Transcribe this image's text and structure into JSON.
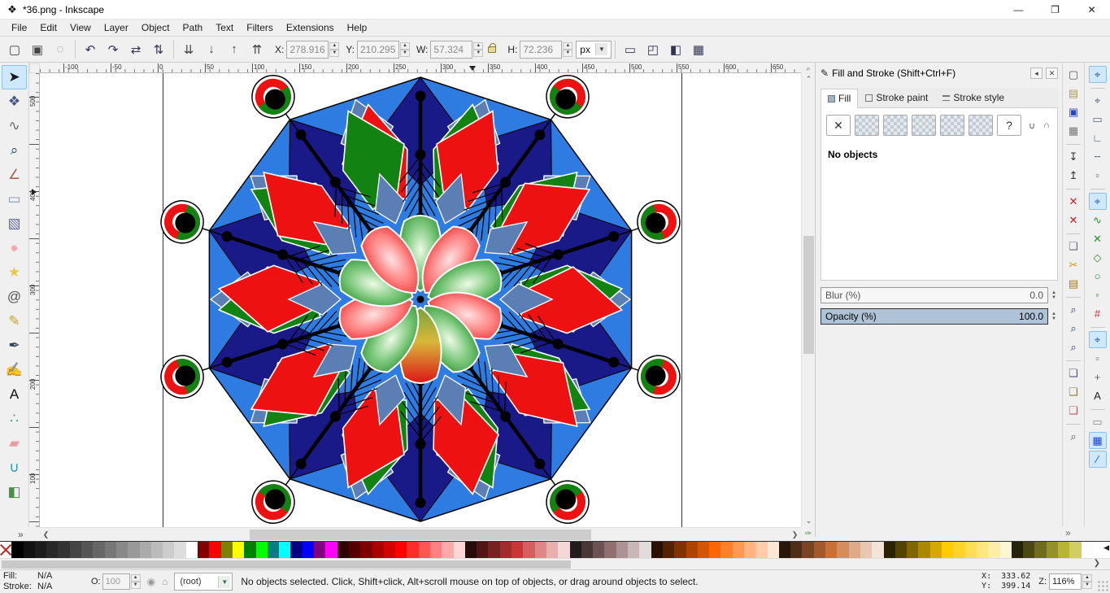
{
  "window": {
    "title": "*36.png - Inkscape",
    "app_icon_glyph": "❖",
    "minimize_glyph": "—",
    "maximize_glyph": "❐",
    "close_glyph": "✕"
  },
  "menu": {
    "items": [
      {
        "label": "File"
      },
      {
        "label": "Edit"
      },
      {
        "label": "View"
      },
      {
        "label": "Layer"
      },
      {
        "label": "Object"
      },
      {
        "label": "Path"
      },
      {
        "label": "Text"
      },
      {
        "label": "Filters"
      },
      {
        "label": "Extensions"
      },
      {
        "label": "Help"
      }
    ]
  },
  "ctrlbar": {
    "buttons_left": [
      {
        "name": "select-all",
        "glyph": "▢",
        "color": "#444"
      },
      {
        "name": "select-all-layers",
        "glyph": "▣",
        "color": "#444"
      },
      {
        "name": "deselect",
        "glyph": "◌",
        "color": "#888"
      },
      {
        "sep": true
      },
      {
        "name": "rotate-ccw",
        "glyph": "↶",
        "color": "#335"
      },
      {
        "name": "rotate-cw",
        "glyph": "↷",
        "color": "#335"
      },
      {
        "name": "flip-horizontal",
        "glyph": "⇄",
        "color": "#335"
      },
      {
        "name": "flip-vertical",
        "glyph": "⇅",
        "color": "#335"
      },
      {
        "sep": true
      },
      {
        "name": "lower-to-bottom",
        "glyph": "⇊",
        "color": "#444"
      },
      {
        "name": "lower",
        "glyph": "↓",
        "color": "#444"
      },
      {
        "name": "raise",
        "glyph": "↑",
        "color": "#444"
      },
      {
        "name": "raise-to-top",
        "glyph": "⇈",
        "color": "#444"
      }
    ],
    "fields": {
      "x_label": "X:",
      "x_value": "278.916",
      "y_label": "Y:",
      "y_value": "210.295",
      "w_label": "W:",
      "w_value": "57.324",
      "h_label": "H:",
      "h_value": "72.236",
      "unit": "px"
    },
    "toggles": [
      {
        "name": "transform-stroke",
        "glyph": "▭",
        "on": true,
        "color": "#335"
      },
      {
        "name": "transform-corners",
        "glyph": "◰",
        "on": true,
        "color": "#335"
      },
      {
        "name": "transform-gradients",
        "glyph": "◧",
        "on": true,
        "color": "#335"
      },
      {
        "name": "transform-patterns",
        "glyph": "▦",
        "on": true,
        "color": "#335"
      }
    ]
  },
  "toolbox": {
    "overflow_glyph": "»",
    "tools": [
      {
        "name": "selector",
        "glyph": "➤",
        "color": "#1a1a1a",
        "active": true
      },
      {
        "name": "node-editor",
        "glyph": "❖",
        "color": "#445588"
      },
      {
        "name": "tweak",
        "glyph": "∿",
        "color": "#666677"
      },
      {
        "name": "zoom",
        "glyph": "⌕",
        "color": "#224477"
      },
      {
        "name": "measure",
        "glyph": "∠",
        "color": "#aa6655"
      },
      {
        "name": "rectangle",
        "glyph": "▭",
        "color": "#7799bb"
      },
      {
        "name": "box-3d",
        "glyph": "▧",
        "color": "#6666aa"
      },
      {
        "name": "ellipse",
        "glyph": "●",
        "color": "#f2a9b2"
      },
      {
        "name": "star",
        "glyph": "★",
        "color": "#e8c94a"
      },
      {
        "name": "spiral",
        "glyph": "@",
        "color": "#555555"
      },
      {
        "name": "pencil",
        "glyph": "✎",
        "color": "#c9a227"
      },
      {
        "name": "bezier-pen",
        "glyph": "✒",
        "color": "#334455"
      },
      {
        "name": "calligraphy",
        "glyph": "✍",
        "color": "#223366"
      },
      {
        "name": "text",
        "glyph": "A",
        "color": "#111111"
      },
      {
        "name": "spray",
        "glyph": "∴",
        "color": "#33aa77"
      },
      {
        "name": "eraser",
        "glyph": "▰",
        "color": "#e8a0a8"
      },
      {
        "name": "paint-bucket",
        "glyph": "∪",
        "color": "#2299aa"
      },
      {
        "name": "gradient",
        "glyph": "◧",
        "color": "#4a8f4a"
      }
    ]
  },
  "rulers": {
    "h_labels": [
      -100,
      -50,
      0,
      50,
      100,
      150,
      200,
      250,
      300,
      350,
      400,
      450,
      500,
      550,
      600,
      650
    ],
    "v_labels": [
      500,
      400,
      300,
      200,
      100
    ]
  },
  "canvas": {
    "artwork": {
      "navy": "#191987",
      "cornflower": "#2e7ce2",
      "slate": "#5b7fb4",
      "red": "#ee1111",
      "green": "#128212",
      "outline": "#000000",
      "white": "#ffffff",
      "petal_red_light": "#ffe2e2",
      "petal_red_mid": "#ff8585",
      "petal_red_dark": "#dd0f0f",
      "petal_green_light": "#eefbe6",
      "petal_green_mid": "#7cc87c",
      "petal_green_dark": "#0e7a10",
      "petal_mix_top": "#dd1515",
      "petal_mix_mid": "#d8b83a",
      "petal_mix_bottom": "#76a23a"
    }
  },
  "panel": {
    "title": "Fill and Stroke (Shift+Ctrl+F)",
    "header_icon_glyph": "✎",
    "cycle_glyph": "◂",
    "close_glyph": "✕",
    "tabs": [
      {
        "label": "Fill",
        "active": true
      },
      {
        "label": "Stroke paint"
      },
      {
        "label": "Stroke style"
      }
    ],
    "paint_buttons": [
      {
        "name": "no-paint",
        "glyph": "✕",
        "plain": true
      },
      {
        "name": "flat-color",
        "glyph": ""
      },
      {
        "name": "linear-gradient",
        "glyph": ""
      },
      {
        "name": "radial-gradient",
        "glyph": ""
      },
      {
        "name": "pattern",
        "glyph": ""
      },
      {
        "name": "swatch",
        "glyph": ""
      },
      {
        "name": "unknown-paint",
        "glyph": "?",
        "plain": true
      }
    ],
    "fillrule": [
      {
        "name": "fill-rule-evenodd",
        "glyph": "∪"
      },
      {
        "name": "fill-rule-nonzero",
        "glyph": "∩"
      }
    ],
    "empty_message": "No objects",
    "blur_label": "Blur (%)",
    "blur_value": "0.0",
    "opacity_label": "Opacity (%)",
    "opacity_value": "100.0"
  },
  "commands_bar": [
    {
      "name": "new-document",
      "glyph": "▢",
      "color": "#555555"
    },
    {
      "name": "open-document",
      "glyph": "▤",
      "color": "#aa9955"
    },
    {
      "name": "save-document",
      "glyph": "▣",
      "color": "#2244cc"
    },
    {
      "name": "print",
      "glyph": "▦",
      "color": "#777777"
    },
    {
      "sep": true
    },
    {
      "name": "import",
      "glyph": "↧",
      "color": "#333333"
    },
    {
      "name": "export",
      "glyph": "↥",
      "color": "#333333"
    },
    {
      "sep": true
    },
    {
      "name": "undo",
      "glyph": "✕",
      "color": "#cc2222"
    },
    {
      "name": "redo",
      "glyph": "✕",
      "color": "#cc2222"
    },
    {
      "sep": true
    },
    {
      "name": "copy",
      "glyph": "❏",
      "color": "#666677"
    },
    {
      "name": "cut",
      "glyph": "✂",
      "color": "#cc9900"
    },
    {
      "name": "paste",
      "glyph": "▤",
      "color": "#aa7722"
    },
    {
      "sep": true
    },
    {
      "name": "zoom-to-selection",
      "glyph": "⌕",
      "color": "#224477"
    },
    {
      "name": "zoom-to-drawing",
      "glyph": "⌕",
      "color": "#224477"
    },
    {
      "name": "zoom-to-page",
      "glyph": "⌕",
      "color": "#224477"
    },
    {
      "sep": true
    },
    {
      "name": "duplicate",
      "glyph": "❏",
      "color": "#555577"
    },
    {
      "name": "create-clone",
      "glyph": "❏",
      "color": "#887744"
    },
    {
      "name": "unlink-clone",
      "glyph": "❏",
      "color": "#bb5555"
    },
    {
      "sep": true
    },
    {
      "name": "find-replace",
      "glyph": "⌕",
      "color": "#555555"
    }
  ],
  "snap_bar": [
    {
      "name": "snap-enable",
      "glyph": "⌖",
      "color": "#2255aa",
      "on": true
    },
    {
      "sep": true
    },
    {
      "name": "snap-bbox",
      "glyph": "⌖",
      "color": "#556677"
    },
    {
      "name": "snap-bbox-edges",
      "glyph": "▭",
      "color": "#556677"
    },
    {
      "name": "snap-bbox-corners",
      "glyph": "∟",
      "color": "#556677"
    },
    {
      "name": "snap-bbox-edge-midpoints",
      "glyph": "╌",
      "color": "#556677"
    },
    {
      "name": "snap-bbox-centers",
      "glyph": "▫",
      "color": "#556677"
    },
    {
      "sep": true
    },
    {
      "name": "snap-nodes",
      "glyph": "⌖",
      "color": "#2255aa",
      "on": true
    },
    {
      "name": "snap-paths",
      "glyph": "∿",
      "color": "#338833"
    },
    {
      "name": "snap-path-intersections",
      "glyph": "✕",
      "color": "#338833"
    },
    {
      "name": "snap-cusp-nodes",
      "glyph": "◇",
      "color": "#338833"
    },
    {
      "name": "snap-smooth-nodes",
      "glyph": "○",
      "color": "#338833"
    },
    {
      "name": "snap-line-midpoints",
      "glyph": "◦",
      "color": "#338833"
    },
    {
      "name": "snap-object-points",
      "glyph": "#",
      "color": "#cc3333"
    },
    {
      "sep": true
    },
    {
      "name": "snap-others",
      "glyph": "⌖",
      "color": "#2255aa",
      "on": true
    },
    {
      "name": "snap-object-centers",
      "glyph": "▫",
      "color": "#556677"
    },
    {
      "name": "snap-rotation-centers",
      "glyph": "+",
      "color": "#556677"
    },
    {
      "name": "snap-text-baseline",
      "glyph": "A",
      "color": "#222222"
    },
    {
      "sep": true
    },
    {
      "name": "snap-page-border",
      "glyph": "▭",
      "color": "#888888"
    },
    {
      "name": "snap-grids",
      "glyph": "▦",
      "color": "#2244cc",
      "on": true
    },
    {
      "name": "snap-guides",
      "glyph": "∕",
      "color": "#2244cc",
      "on": true
    }
  ],
  "toolbars_overflow_glyph": "»",
  "scroll": {
    "up_glyph": "⌃",
    "down_glyph": "⌄",
    "left_glyph": "❮",
    "right_glyph": "❯",
    "sticky_zoom_glyph": "⌕",
    "cms_glyph": "✑",
    "palette_left_glyph": "◀",
    "palette_right_glyph": "❯"
  },
  "palette": {
    "colors": [
      "none",
      "#000000",
      "#111111",
      "#1c1c1c",
      "#282828",
      "#333333",
      "#444444",
      "#555555",
      "#666666",
      "#777777",
      "#888888",
      "#999999",
      "#aaaaaa",
      "#bbbbbb",
      "#cccccc",
      "#dddddd",
      "#ffffff",
      "#800000",
      "#ff0000",
      "#808000",
      "#ffff00",
      "#008000",
      "#00ff00",
      "#008080",
      "#00ffff",
      "#000080",
      "#0000ff",
      "#800080",
      "#ff00ff",
      "#330000",
      "#550000",
      "#800000",
      "#aa0000",
      "#d40000",
      "#ff0000",
      "#ff2a2a",
      "#ff5555",
      "#ff8080",
      "#ffaaaa",
      "#ffd5d5",
      "#280b0b",
      "#501616",
      "#782121",
      "#a02c2c",
      "#c83737",
      "#d35f5f",
      "#de8787",
      "#e9afaf",
      "#f4d7d7",
      "#241c1c",
      "#483737",
      "#6c5353",
      "#916f6f",
      "#ac9393",
      "#c8b7b7",
      "#e3dbdb",
      "#2b1100",
      "#552200",
      "#803300",
      "#aa4400",
      "#d45500",
      "#ff6600",
      "#ff7f2a",
      "#ff9955",
      "#ffb380",
      "#ffccaa",
      "#ffe6d5",
      "#28170b",
      "#502d16",
      "#784421",
      "#a05a2c",
      "#c87137",
      "#d38d5f",
      "#deaa87",
      "#e9c6af",
      "#f4e3d7",
      "#2b2200",
      "#554400",
      "#806600",
      "#aa8800",
      "#d4aa00",
      "#ffcc00",
      "#ffd42a",
      "#ffdd55",
      "#ffe680",
      "#ffeeaa",
      "#fff6d5",
      "#25240b",
      "#4a4816",
      "#6f6c21",
      "#94902c",
      "#b9b437",
      "#d4cd62"
    ]
  },
  "statusbar": {
    "fill_label": "Fill:",
    "fill_value": "N/A",
    "stroke_label": "Stroke:",
    "stroke_value": "N/A",
    "opacity_label": "O:",
    "opacity_value": "100",
    "eye_glyph": "◉",
    "lock_glyph": "⌂",
    "layer_name": "(root)",
    "message": "No objects selected. Click, Shift+click, Alt+scroll mouse on top of objects, or drag around objects to select.",
    "cursor_x": "333.62",
    "cursor_y": "399.14",
    "x_prefix": "X:",
    "y_prefix": "Y:",
    "zoom_label": "Z:",
    "zoom_value": "116%"
  }
}
